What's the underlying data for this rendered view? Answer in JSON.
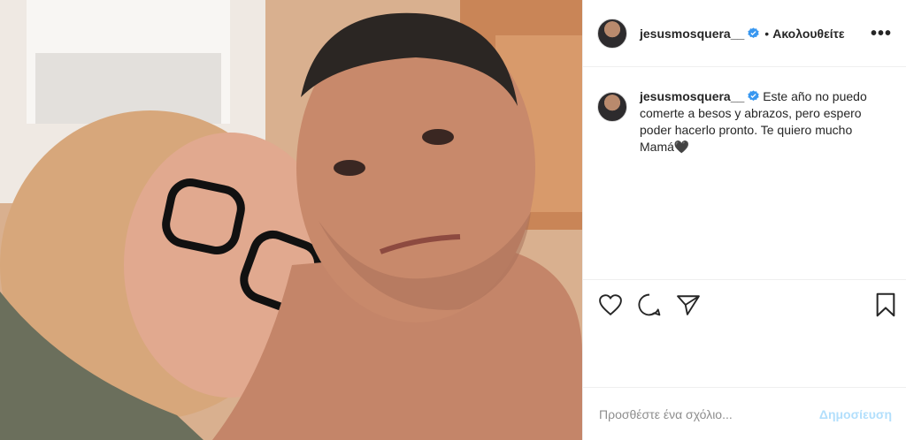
{
  "post": {
    "username": "jesusmosquera__",
    "follow_separator": "•",
    "follow_label": "Ακολουθείτε",
    "more_icon": "more-icon",
    "more_glyph": "•••",
    "caption": "Este año no puedo comerte a besos y abrazos, pero espero poder hacerlo pronto. Te quiero mucho Mamá🖤"
  },
  "actions": {
    "like_icon": "heart-icon",
    "comment_icon": "comment-icon",
    "share_icon": "share-icon",
    "save_icon": "bookmark-icon"
  },
  "comment": {
    "placeholder": "Προσθέστε ένα σχόλιο...",
    "publish_label": "Δημοσίευση"
  },
  "colors": {
    "verified": "#3897f0",
    "publish_disabled": "#b2dffc",
    "divider": "#efefef"
  }
}
